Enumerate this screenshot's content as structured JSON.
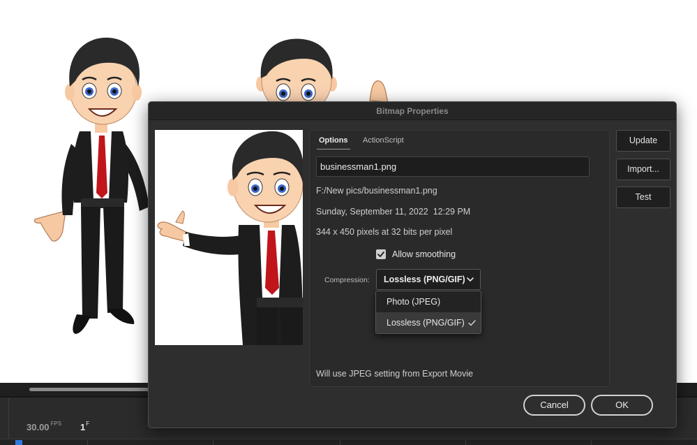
{
  "dialog": {
    "title": "Bitmap Properties",
    "tabs": [
      {
        "label": "Options",
        "active": true
      },
      {
        "label": "ActionScript",
        "active": false
      }
    ],
    "name_value": "businessman1.png",
    "path": "F:/New pics/businessman1.png",
    "date": "Sunday, September 11, 2022  12:29 PM",
    "dimensions": "344 x 450 pixels at 32 bits per pixel",
    "allow_smoothing": {
      "label": "Allow smoothing",
      "checked": true
    },
    "compression": {
      "label": "Compression:",
      "selected": "Lossless (PNG/GIF)",
      "options": [
        "Photo (JPEG)",
        "Lossless (PNG/GIF)"
      ]
    },
    "jpeg_note": "Will use JPEG setting from Export Movie",
    "side_buttons": {
      "update": "Update",
      "import": "Import...",
      "test": "Test"
    },
    "footer_buttons": {
      "cancel": "Cancel",
      "ok": "OK"
    }
  },
  "timeline": {
    "fps": "30.00",
    "fps_unit": "FPS",
    "frame": "1",
    "frame_unit": "F"
  },
  "colors": {
    "dialog_bg": "#2e2e2e",
    "tie": "#c0161b",
    "suit": "#1d1d1d",
    "accent_blue": "#2f7be0"
  },
  "icons": {
    "checkbox": "checkmark-icon",
    "select_chevron": "chevron-down-icon",
    "menu_check": "checkmark-icon"
  }
}
